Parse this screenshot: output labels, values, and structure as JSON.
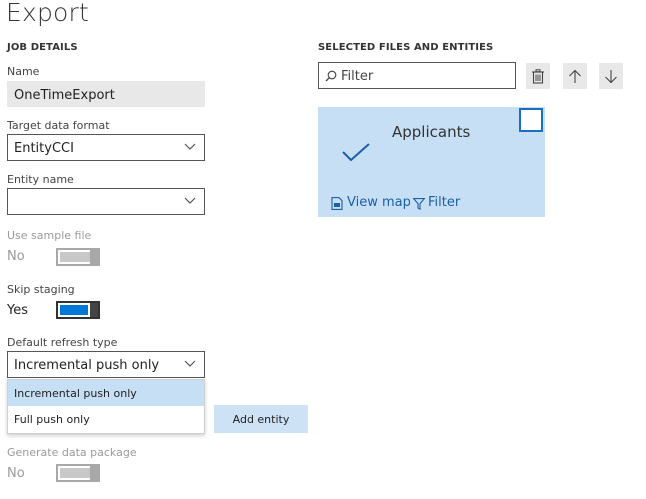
{
  "page": {
    "title": "Export"
  },
  "job_details": {
    "header": "JOB DETAILS",
    "name": {
      "label": "Name",
      "value": "OneTimeExport"
    },
    "target_data_format": {
      "label": "Target data format",
      "value": "EntityCCI"
    },
    "entity_name": {
      "label": "Entity name",
      "value": ""
    },
    "use_sample_file": {
      "label": "Use sample file",
      "value": "No",
      "on": false,
      "enabled": false
    },
    "skip_staging": {
      "label": "Skip staging",
      "value": "Yes",
      "on": true,
      "enabled": true
    },
    "default_refresh_type": {
      "label": "Default refresh type",
      "value": "Incremental push only",
      "options": [
        "Incremental push only",
        "Full push only"
      ],
      "highlighted_option": "Incremental push only"
    },
    "add_entity_label": "Add entity",
    "generate_data_package": {
      "label": "Generate data package",
      "value": "No",
      "on": false,
      "enabled": false
    }
  },
  "selected_files": {
    "header": "SELECTED FILES AND ENTITIES",
    "filter": {
      "placeholder": "Filter"
    },
    "toolbar_icons": [
      "delete-icon",
      "arrow-up-icon",
      "arrow-down-icon"
    ],
    "tiles": [
      {
        "title": "Applicants",
        "view_map_label": "View map",
        "filter_label": "Filter",
        "checked": false
      }
    ]
  },
  "colors": {
    "accent": "#0078d7",
    "tile_background": "#c7dff4",
    "link": "#1a5fa8",
    "readonly_field": "#e8e8e8"
  }
}
